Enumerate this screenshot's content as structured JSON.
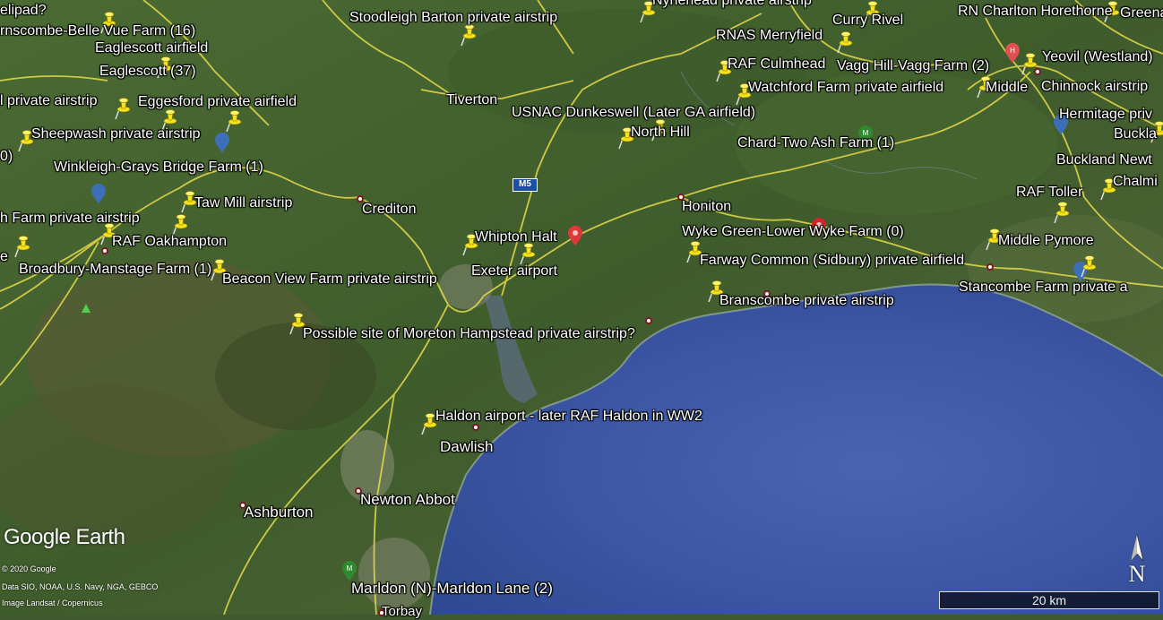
{
  "labels": {
    "l01": "elipad?",
    "l02": "rnscombe-Belle Vue Farm (16)",
    "l03": "Eaglescott airfield",
    "l04": "Eaglescott (37)",
    "l05": "l private airstrip",
    "l06": "Eggesford private airfield",
    "l07": "Sheepwash private airstrip",
    "l08": "0)",
    "l09": "Winkleigh-Grays Bridge Farm (1)",
    "l10": "Taw Mill airstrip",
    "l11": "h Farm private airstrip",
    "l12": "RAF Oakhampton",
    "l13": "e",
    "l14": "Broadbury-Manstage Farm (1)",
    "l15": "Beacon View Farm private airstrip",
    "l16": "Crediton",
    "l17": "Stoodleigh Barton private airstrip",
    "l18": "Tiverton",
    "l19": "Nynehead private airstrip",
    "l20": "Curry Rivel",
    "l21": "RN Charlton Horethorne",
    "l22": "Greena",
    "l23": "RNAS Merryfield",
    "l24": "RAF Culmhead",
    "l25": "Vagg Hill-Vagg Farm (2)",
    "l26": "Yeovil (Westland)",
    "l27": "Watchford Farm private airfield",
    "l28": "Middle",
    "l29": "Chinnock airstrip",
    "l30": "USNAC Dunkeswell (Later GA airfield)",
    "l31": "North Hill",
    "l32": "Chard-Two Ash Farm (1)",
    "l33": "Hermitage priv",
    "l34": "Buckla",
    "l35": "Buckland Newt",
    "l36": "RAF Toller",
    "l37": "Chalmi",
    "l38": "Honiton",
    "l39": "Wyke Green-Lower Wyke Farm (0)",
    "l40": "Middle Pymore",
    "l41": "Farway Common (Sidbury) private airfield",
    "l42": "Stancombe Farm private a",
    "l43": "Whipton Halt",
    "l44": "Exeter airport",
    "l45": "Branscombe private airstrip",
    "l46": "Possible site of Moreton Hampstead private airstrip?",
    "l47": "Haldon airport - later RAF Haldon in WW2",
    "l48": "Dawlish",
    "l49": "Newton Abbot",
    "l50": "Ashburton",
    "l51": "Marldon (N)-Marldon Lane (2)",
    "l52": "Torbay"
  },
  "road_shield": "M5",
  "branding": {
    "logo": "Google Earth",
    "copyright": "© 2020 Google",
    "data_credit": "Data SIO, NOAA, U.S. Navy, NGA, GEBCO",
    "image_credit": "Image Landsat / Copernicus"
  },
  "compass_letter": "N",
  "scale_text": "20 km",
  "colors": {
    "pin": "#f5e21b",
    "road": "#e8dc4a",
    "sea": "#3d55a3",
    "land": "#44602f",
    "town_dot": "#7a1b22"
  }
}
